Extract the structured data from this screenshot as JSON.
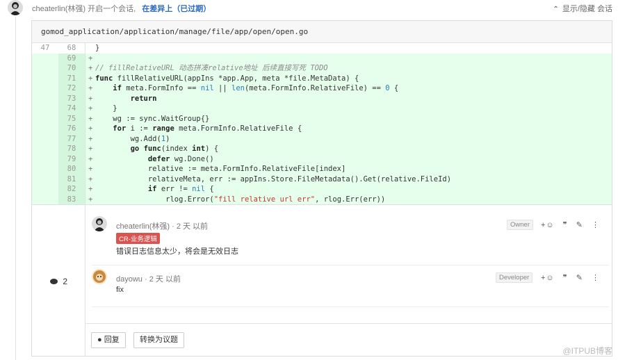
{
  "header": {
    "author": "cheaterlin(林强)",
    "action_text": "开启一个会话,",
    "branch_text": "在差异上（已过期）",
    "toggle_label": "显示/隐藏 会话"
  },
  "diff": {
    "file_path": "gomod_application/application/manage/file/app/open/open.go",
    "lines": [
      {
        "old": "47",
        "new": "68",
        "sign": "",
        "type": "ctx",
        "code": "}"
      },
      {
        "old": "",
        "new": "69",
        "sign": "+",
        "type": "added",
        "code": ""
      },
      {
        "old": "",
        "new": "70",
        "sign": "+",
        "type": "added",
        "code": "// fillRelativeURL 动态拼凑relative地址 后续直接写死 TODO"
      },
      {
        "old": "",
        "new": "71",
        "sign": "+",
        "type": "added",
        "code": "func fillRelativeURL(appIns *app.App, meta *file.MetaData) {"
      },
      {
        "old": "",
        "new": "72",
        "sign": "+",
        "type": "added",
        "code": "    if meta.FormInfo == nil || len(meta.FormInfo.RelativeFile) == 0 {"
      },
      {
        "old": "",
        "new": "73",
        "sign": "+",
        "type": "added",
        "code": "        return"
      },
      {
        "old": "",
        "new": "74",
        "sign": "+",
        "type": "added",
        "code": "    }"
      },
      {
        "old": "",
        "new": "75",
        "sign": "+",
        "type": "added",
        "code": "    wg := sync.WaitGroup{}"
      },
      {
        "old": "",
        "new": "76",
        "sign": "+",
        "type": "added",
        "code": "    for i := range meta.FormInfo.RelativeFile {"
      },
      {
        "old": "",
        "new": "77",
        "sign": "+",
        "type": "added",
        "code": "        wg.Add(1)"
      },
      {
        "old": "",
        "new": "78",
        "sign": "+",
        "type": "added",
        "code": "        go func(index int) {"
      },
      {
        "old": "",
        "new": "79",
        "sign": "+",
        "type": "added",
        "code": "            defer wg.Done()"
      },
      {
        "old": "",
        "new": "80",
        "sign": "+",
        "type": "added",
        "code": "            relative := meta.FormInfo.RelativeFile[index]"
      },
      {
        "old": "",
        "new": "81",
        "sign": "+",
        "type": "added",
        "code": "            relativeMeta, err := appIns.Store.FileMetadata().Get(relative.FileId)"
      },
      {
        "old": "",
        "new": "82",
        "sign": "+",
        "type": "added",
        "code": "            if err != nil {"
      },
      {
        "old": "",
        "new": "83",
        "sign": "+",
        "type": "added",
        "code": "                rlog.Error(\"fill relative url err\", rlog.Err(err))"
      }
    ]
  },
  "discussion": {
    "count": "2",
    "notes": [
      {
        "author": "cheaterlin(林强)",
        "time": "2 天 以前",
        "role": "Owner",
        "label": "CR-业务逻辑",
        "body": "错误日志信息太少，将会是无效日志"
      },
      {
        "author": "dayowu",
        "time": "2 天 以前",
        "role": "Developer",
        "body": "fix"
      }
    ],
    "actions": {
      "emoji": "+☺",
      "quote": "❞",
      "edit": "✎",
      "more": "⋮"
    },
    "reply_label": "回复",
    "convert_label": "转换为议题"
  },
  "watermark": "@ITPUB博客"
}
